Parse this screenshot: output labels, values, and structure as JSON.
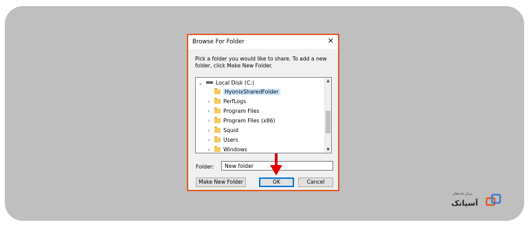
{
  "dialog": {
    "title": "Browse For Folder",
    "instruction": "Pick a folder you would like to share. To add a new folder, click Make New Folder.",
    "tree": {
      "root": "Local Disk (C:)",
      "items": [
        {
          "label": "HyonixSharedFolder",
          "selected": true
        },
        {
          "label": "PerfLogs"
        },
        {
          "label": "Program Files"
        },
        {
          "label": "Program Files (x86)"
        },
        {
          "label": "Squid"
        },
        {
          "label": "Users"
        },
        {
          "label": "Windows"
        }
      ]
    },
    "folder_label": "Folder:",
    "folder_value": "New folder",
    "buttons": {
      "make_new": "Make New Folder",
      "ok": "OK",
      "cancel": "Cancel"
    }
  },
  "branding": {
    "logo_subtext": "مرکز داده‌های",
    "logo_text": "آسیاتک"
  },
  "colors": {
    "highlight_border": "#e05a2b",
    "arrow": "#e00000",
    "selection": "#cce8ff",
    "ok_border": "#0078d7"
  }
}
